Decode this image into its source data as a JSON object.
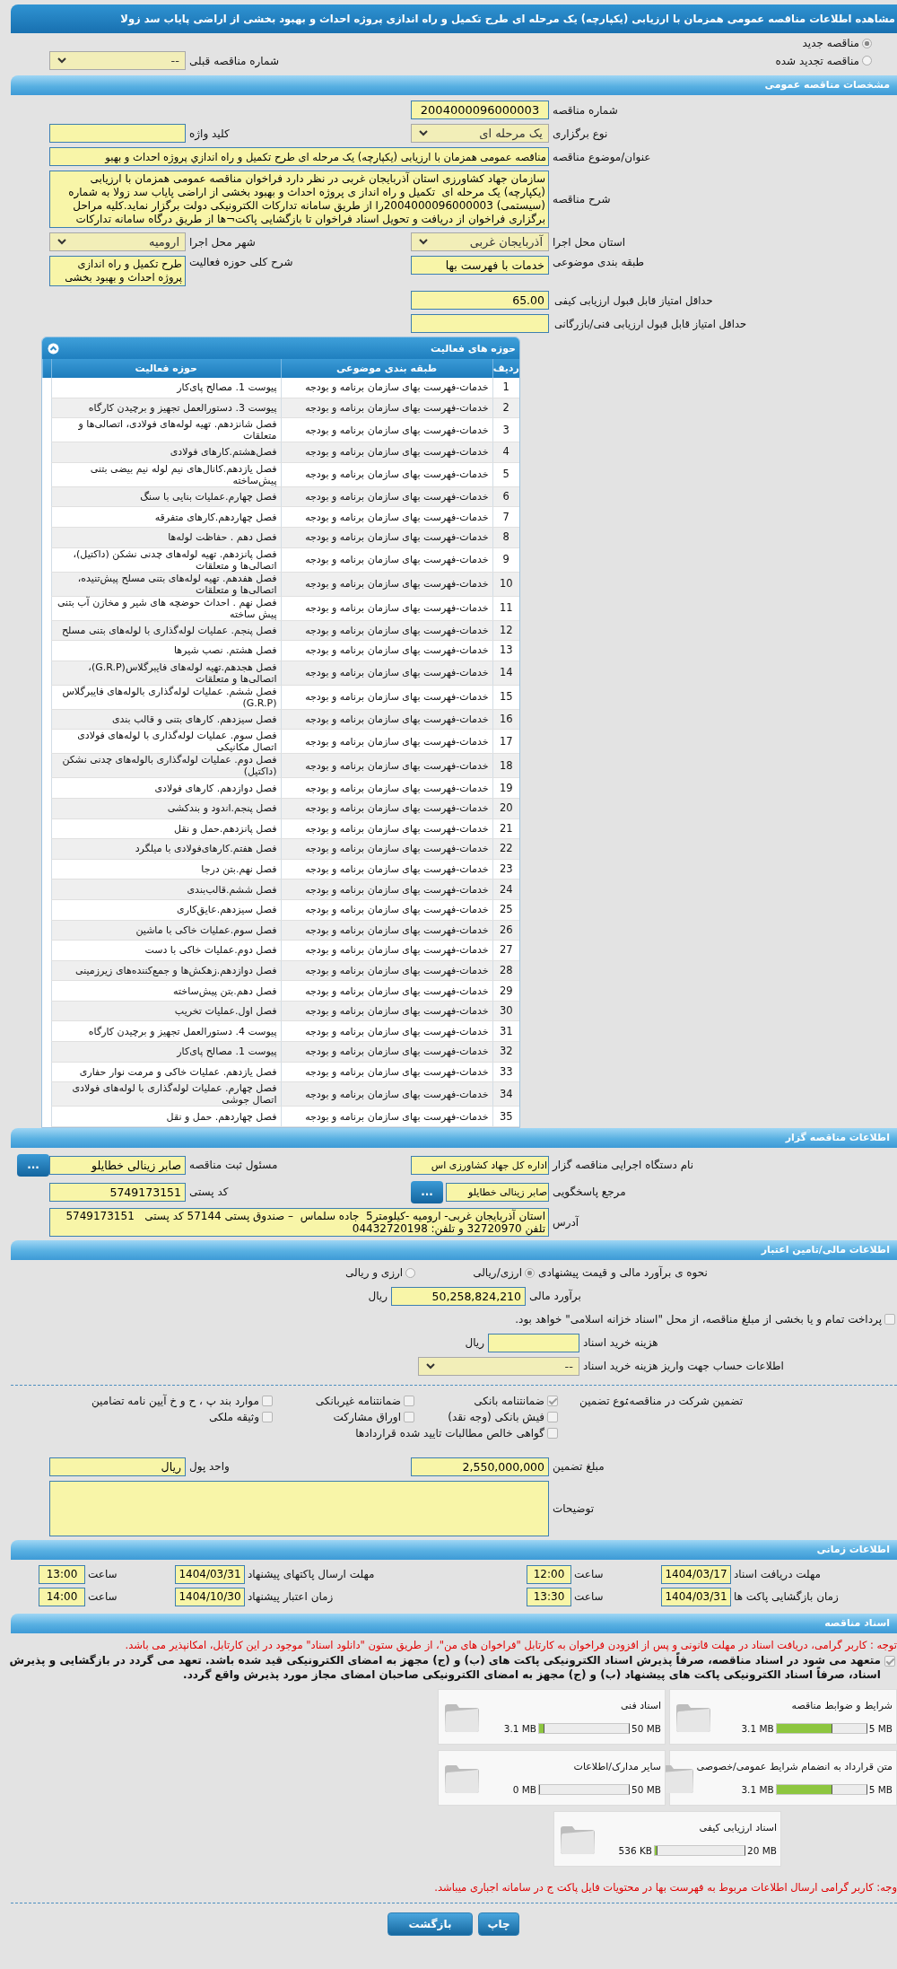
{
  "page_title": "مشاهده اطلاعات مناقصه عمومی همزمان با ارزیابی (یکپارچه) یک مرحله ای طرح تکمیل و راه اندازی پروژه احداث و بهبود بخشی از اراضی پایاب سد زولا",
  "tender_status": [
    {
      "label": "مناقصه جدید",
      "selected": true
    },
    {
      "label": "مناقصه تجدید شده",
      "selected": false
    }
  ],
  "previous_tender": {
    "label": "شماره مناقصه قبلی",
    "value": "--"
  },
  "general": {
    "title": "مشخصات مناقصه عمومی",
    "tender_number": {
      "label": "شماره مناقصه",
      "value": "2004000096000003"
    },
    "holding_type": {
      "label": "نوع برگزاری",
      "value": "یک مرحله ای"
    },
    "keyword": {
      "label": "کلید واژه"
    },
    "subject": {
      "label": "عنوان/موضوع مناقصه",
      "value": "مناقصه عمومی همزمان با ارزیابی (یکپارچه) یک مرحله ای طرح تکمیل و راه اندازي پروژه احداث و بهبو"
    },
    "description": {
      "label": "شرح مناقصه",
      "value": "سازمان جهاد کشاورزی استان آذربایجان غربی در نظر دارد فراخوان مناقصه عمومی همزمان با ارزیابی (یکپارچه) یک مرحله ای  تکمیل و راه انداز ی پروژه احداث و بهبود بخشی از اراضی پایاب سد زولا به شماره (سیستمی) 2004000096000003را از طریق سامانه تدارکات الکترونیکی دولت برگزار نماید.کلیه مراحل برگزاری فراخوان از دریافت و تحویل اسناد فراخوان تا بازگشایی پاکت¬ها از طریق درگاه سامانه تدارکات"
    },
    "province": {
      "label": "استان محل اجرا",
      "value": "آذربایجان غربی"
    },
    "city": {
      "label": "شهر محل اجرا",
      "value": "ارومیه"
    },
    "category": {
      "label": "طبقه بندی موضوعی",
      "value": "خدمات با فهرست بها"
    },
    "activity_scope": {
      "label": "شرح کلی حوزه فعالیت",
      "value": "طرح تکمیل و راه اندازی پروژه احداث و بهبود بخشی"
    },
    "min_quality_score": {
      "label": "حداقل امتیاز قابل قبول ارزیابی کیفی",
      "value": "65.00"
    },
    "min_technical_score": {
      "label": "حداقل امتیاز قابل قبول ارزیابی فنی/بازرگانی"
    }
  },
  "activities": {
    "title": "حوزه های فعالیت",
    "columns": [
      "ردیف",
      "طبقه بندی موضوعی",
      "حوزه فعالیت"
    ],
    "rows": [
      {
        "index": "1",
        "category": "خدمات-فهرست بهای سازمان برنامه و بودجه",
        "activity": "پیوست 1. مصالح پای‌کار"
      },
      {
        "index": "2",
        "category": "خدمات-فهرست بهای سازمان برنامه و بودجه",
        "activity": "پیوست 3. دستورالعمل تجهیز و برچیدن کارگاه"
      },
      {
        "index": "3",
        "category": "خدمات-فهرست بهای سازمان برنامه و بودجه",
        "activity": "فصل شانزدهم. تهیه لوله‌های فولادی، اتصالی‌ها و متعلقات"
      },
      {
        "index": "4",
        "category": "خدمات-فهرست بهای سازمان برنامه و بودجه",
        "activity": "فصل‌هشتم.کارهای فولادی"
      },
      {
        "index": "5",
        "category": "خدمات-فهرست بهای سازمان برنامه و بودجه",
        "activity": "فصل یازدهم.کانال‌های نیم لوله نیم بیضی بتنی پیش‌ساخته"
      },
      {
        "index": "6",
        "category": "خدمات-فهرست بهای سازمان برنامه و بودجه",
        "activity": "فصل چهارم.عملیات بنایی با سنگ"
      },
      {
        "index": "7",
        "category": "خدمات-فهرست بهای سازمان برنامه و بودجه",
        "activity": "فصل چهاردهم.کارهای متفرقه"
      },
      {
        "index": "8",
        "category": "خدمات-فهرست بهای سازمان برنامه و بودجه",
        "activity": "فصل دهم . حفاظت لوله‌ها"
      },
      {
        "index": "9",
        "category": "خدمات-فهرست بهای سازمان برنامه و بودجه",
        "activity": "فصل پانزدهم. تهیه لوله‌های چدنی نشکن (داکتیل)، اتصالی‌ها و متعلقات"
      },
      {
        "index": "10",
        "category": "خدمات-فهرست بهای سازمان برنامه و بودجه",
        "activity": "فصل هفدهم. تهیه لوله‌های بتنی مسلح پیش‌تنیده، اتصالی‌ها و متعلقات"
      },
      {
        "index": "11",
        "category": "خدمات-فهرست بهای سازمان برنامه و بودجه",
        "activity": "فصل نهم . احداث حوضچه های شیر و مخازن آب بتنی پیش ساخته"
      },
      {
        "index": "12",
        "category": "خدمات-فهرست بهای سازمان برنامه و بودجه",
        "activity": "فصل پنجم. عملیات لوله‌گذاری با لوله‌های بتنی مسلح"
      },
      {
        "index": "13",
        "category": "خدمات-فهرست بهای سازمان برنامه و بودجه",
        "activity": "فصل هشتم. نصب شیرها"
      },
      {
        "index": "14",
        "category": "خدمات-فهرست بهای سازمان برنامه و بودجه",
        "activity": "فصل هجدهم.تهیه لوله‌های فایبرگلاس(G.R.P)، اتصالی‌ها و متعلقات"
      },
      {
        "index": "15",
        "category": "خدمات-فهرست بهای سازمان برنامه و بودجه",
        "activity": "فصل ششم. عملیات لوله‌گذاری بالوله‌های فایبرگلاس (G.R.P)"
      },
      {
        "index": "16",
        "category": "خدمات-فهرست بهای سازمان برنامه و بودجه",
        "activity": "فصل سیزدهم. کارهای بتنی و قالب بندی"
      },
      {
        "index": "17",
        "category": "خدمات-فهرست بهای سازمان برنامه و بودجه",
        "activity": "فصل سوم. عملیات لوله‌گذاری با لوله‌های فولادی اتصال مکانیکی"
      },
      {
        "index": "18",
        "category": "خدمات-فهرست بهای سازمان برنامه و بودجه",
        "activity": "فصل دوم. عملیات لوله‌گذاری بالوله‌های چدنی نشکن (داکتیل)"
      },
      {
        "index": "19",
        "category": "خدمات-فهرست بهای سازمان برنامه و بودجه",
        "activity": "فصل دوازدهم. کارهای فولادی"
      },
      {
        "index": "20",
        "category": "خدمات-فهرست بهای سازمان برنامه و بودجه",
        "activity": "فصل پنجم.اندود و بندکشی"
      },
      {
        "index": "21",
        "category": "خدمات-فهرست بهای سازمان برنامه و بودجه",
        "activity": "فصل پانزدهم.حمل و نقل"
      },
      {
        "index": "22",
        "category": "خدمات-فهرست بهای سازمان برنامه و بودجه",
        "activity": "فصل هفتم.کارهای‌فولادی با میلگرد"
      },
      {
        "index": "23",
        "category": "خدمات-فهرست بهای سازمان برنامه و بودجه",
        "activity": "فصل نهم.بتن درجا"
      },
      {
        "index": "24",
        "category": "خدمات-فهرست بهای سازمان برنامه و بودجه",
        "activity": "فصل ششم.قالب‌بندی"
      },
      {
        "index": "25",
        "category": "خدمات-فهرست بهای سازمان برنامه و بودجه",
        "activity": "فصل سیزدهم.عایق‌کاری"
      },
      {
        "index": "26",
        "category": "خدمات-فهرست بهای سازمان برنامه و بودجه",
        "activity": "فصل سوم.عملیات خاکی با ماشین"
      },
      {
        "index": "27",
        "category": "خدمات-فهرست بهای سازمان برنامه و بودجه",
        "activity": "فصل دوم.عملیات خاکی با دست"
      },
      {
        "index": "28",
        "category": "خدمات-فهرست بهای سازمان برنامه و بودجه",
        "activity": "فصل دوازدهم.زهکش‌ها و جمع‌کننده‌های زیرزمینی"
      },
      {
        "index": "29",
        "category": "خدمات-فهرست بهای سازمان برنامه و بودجه",
        "activity": "فصل دهم.بتن پیش‌ساخته"
      },
      {
        "index": "30",
        "category": "خدمات-فهرست بهای سازمان برنامه و بودجه",
        "activity": "فصل اول.عملیات تخریب"
      },
      {
        "index": "31",
        "category": "خدمات-فهرست بهای سازمان برنامه و بودجه",
        "activity": "پیوست 4. دستورالعمل تجهیز و برچیدن کارگاه"
      },
      {
        "index": "32",
        "category": "خدمات-فهرست بهای سازمان برنامه و بودجه",
        "activity": "پیوست 1. مصالح پای‌کار"
      },
      {
        "index": "33",
        "category": "خدمات-فهرست بهای سازمان برنامه و بودجه",
        "activity": "فصل یازدهم. عملیات خاکی و مرمت نوار حفاری"
      },
      {
        "index": "34",
        "category": "خدمات-فهرست بهای سازمان برنامه و بودجه",
        "activity": "فصل چهارم. عملیات لوله‌گذاری با لوله‌های فولادی اتصال جوشی"
      },
      {
        "index": "35",
        "category": "خدمات-فهرست بهای سازمان برنامه و بودجه",
        "activity": "فصل چهاردهم. حمل و نقل"
      }
    ]
  },
  "organizer": {
    "title": "اطلاعات مناقصه گزار",
    "agency": {
      "label": "نام دستگاه اجرایی مناقصه گزار",
      "value": "اداره کل جهاد کشاورزی اس"
    },
    "responsible": {
      "label": "مسئول ثبت مناقصه",
      "value": "صابر زینالی خطایلو",
      "button": "..."
    },
    "reference": {
      "label": "مرجع پاسخگویی",
      "value": "صابر زینالی خطایلو",
      "button": "..."
    },
    "postal_code": {
      "label": "کد پستی",
      "value": "5749173151"
    },
    "address": {
      "label": "آدرس",
      "value": "استان آذربایجان غربی- ارومیه -کیلومتر5  جاده سلماس  – صندوق پستی 57144 کد پستی   5749173151 تلفن 32720970 و تلفن: 04432720198"
    }
  },
  "finance": {
    "title": "اطلاعات مالی/تامین اعتبار",
    "estimate_method": {
      "label": "نحوه ی برآورد مالی و قیمت پیشنهادی",
      "options": [
        {
          "label": "ارزی/ریالی",
          "selected": true
        },
        {
          "label": "ارزی و ریالی",
          "selected": false
        }
      ]
    },
    "budget": {
      "label": "برآورد مالی",
      "value": "50,258,824,210",
      "unit": "ریال"
    },
    "treasury": {
      "label": "پرداخت تمام و یا بخشی از مبلغ مناقصه، از محل \"اسناد خزانه اسلامی\" خواهد بود.",
      "checked": false
    },
    "document_fee": {
      "label": "هزینه خرید اسناد",
      "unit": "ریال"
    },
    "fee_account": {
      "label": "اطلاعات حساب جهت واریز هزینه خرید اسناد",
      "value": "--"
    },
    "guarantee": {
      "label": "تضمین شرکت در مناقصه:",
      "type_label": "نوع تضمین",
      "options": [
        {
          "label": "ضمانتنامه بانکی",
          "checked": true
        },
        {
          "label": "ضمانتنامه غیربانکی",
          "checked": false
        },
        {
          "label": "موارد بند پ ، ح و خ آیین نامه تضامین",
          "checked": false
        },
        {
          "label": "فیش بانکی (وجه نقد)",
          "checked": false
        },
        {
          "label": "اوراق مشارکت",
          "checked": false
        },
        {
          "label": "وثیقه ملکی",
          "checked": false
        },
        {
          "label": "گواهی خالص مطالبات تایید شده قراردادها",
          "checked": false
        }
      ]
    },
    "amount": {
      "label": "مبلغ تضمین",
      "value": "2,550,000,000"
    },
    "currency": {
      "label": "واحد پول",
      "value": "ریال"
    },
    "notes": {
      "label": "توضیحات"
    }
  },
  "timing": {
    "title": "اطلاعات زمانی",
    "items": [
      {
        "label": "مهلت دریافت اسناد",
        "date": "1404/03/17",
        "time_label": "ساعت",
        "time": "12:00"
      },
      {
        "label": "مهلت ارسال پاکتهای پیشنهاد",
        "date": "1404/03/31",
        "time_label": "ساعت",
        "time": "13:00"
      },
      {
        "label": "زمان بازگشایی پاکت ها",
        "date": "1404/03/31",
        "time_label": "ساعت",
        "time": "13:30"
      },
      {
        "label": "زمان اعتبار پیشنهاد",
        "date": "1404/10/30",
        "time_label": "ساعت",
        "time": "14:00"
      }
    ]
  },
  "documents": {
    "title": "اسناد مناقصه",
    "notice": "توجه : کاربر گرامی، دریافت اسناد در مهلت قانونی و پس از افزودن فراخوان به کارتابل \"فراخوان های من\"، از طریق ستون \"دانلود اسناد\" موجود در این کارتابل، امکانپذیر می باشد.",
    "commitment": {
      "text": "متعهد می شود در اسناد مناقصه، صرفاً پذیرش اسناد الکترونیکی پاکت های (ب) و (ج) مجهز به امضای الکترونیکی قید شده باشد. تعهد می گردد در بازگشایی و پذیرش اسناد، صرفاً اسناد الکترونیکی پاکت های پیشنهاد (ب) و (ج) مجهز به امضای الکترونیکی صاحبان امضای مجاز مورد پذیرش واقع گردد.",
      "checked": true
    },
    "files": [
      {
        "name": "شرایط و ضوابط مناقصه",
        "size": "3.1 MB",
        "max": "5 MB",
        "level": 0.62
      },
      {
        "name": "اسناد فنی",
        "size": "3.1 MB",
        "max": "50 MB",
        "level": 0.062
      },
      {
        "name": "متن قرارداد به انضمام شرایط عمومی/خصوصی",
        "size": "3.1 MB",
        "max": "5 MB",
        "level": 0.62
      },
      {
        "name": "سایر مدارک/اطلاعات",
        "size": "0 MB",
        "max": "50 MB",
        "level": 0
      },
      {
        "name": "اسناد ارزیابی کیفی",
        "size": "536 KB",
        "max": "20 MB",
        "level": 0.026
      }
    ],
    "footer_note": "وجه: کاربر گرامی ارسال اطلاعات مربوط به فهرست بها در محتویات فایل پاکت ج در سامانه اجباری میباشد."
  },
  "buttons": [
    "چاپ",
    "بازگشت"
  ]
}
